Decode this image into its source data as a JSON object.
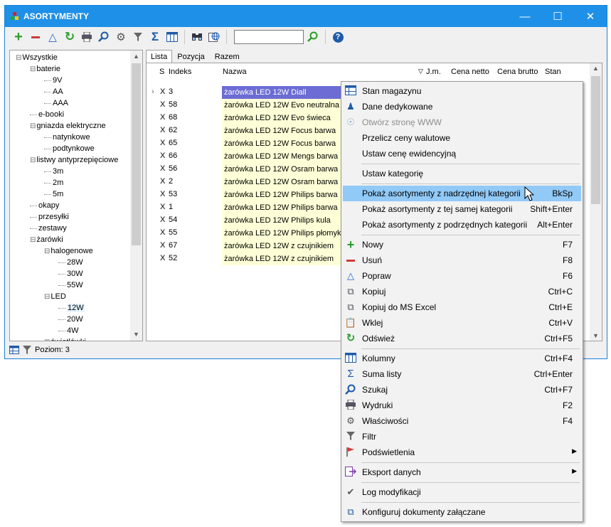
{
  "window": {
    "title": "ASORTYMENTY",
    "minimize": "—",
    "maximize": "☐",
    "close": "✕"
  },
  "toolbar": {
    "search_value": ""
  },
  "tree": {
    "items": [
      {
        "label": "Wszystkie",
        "level": 0,
        "expander": "⊟"
      },
      {
        "label": "baterie",
        "level": 1,
        "expander": "⊟"
      },
      {
        "label": "9V",
        "level": 2
      },
      {
        "label": "AA",
        "level": 2
      },
      {
        "label": "AAA",
        "level": 2
      },
      {
        "label": "e-booki",
        "level": 1
      },
      {
        "label": "gniazda elektryczne",
        "level": 1,
        "expander": "⊟"
      },
      {
        "label": "natynkowe",
        "level": 2
      },
      {
        "label": "podtynkowe",
        "level": 2
      },
      {
        "label": "listwy antyprzepięciowe",
        "level": 1,
        "expander": "⊟"
      },
      {
        "label": "3m",
        "level": 2
      },
      {
        "label": "2m",
        "level": 2
      },
      {
        "label": "5m",
        "level": 2
      },
      {
        "label": "okapy",
        "level": 1
      },
      {
        "label": "przesyłki",
        "level": 1
      },
      {
        "label": "zestawy",
        "level": 1
      },
      {
        "label": "żarówki",
        "level": 1,
        "expander": "⊟"
      },
      {
        "label": "halogenowe",
        "level": 2,
        "expander": "⊟"
      },
      {
        "label": "28W",
        "level": 3
      },
      {
        "label": "30W",
        "level": 3
      },
      {
        "label": "55W",
        "level": 3
      },
      {
        "label": "LED",
        "level": 2,
        "expander": "⊟"
      },
      {
        "label": "12W",
        "level": 3,
        "selected": true
      },
      {
        "label": "20W",
        "level": 3
      },
      {
        "label": "4W",
        "level": 3
      },
      {
        "label": "świetlówki",
        "level": 2,
        "expander": "⊞"
      }
    ]
  },
  "tabs": [
    "Lista",
    "Pozycja",
    "Razem"
  ],
  "grid": {
    "columns": {
      "s": "S",
      "indeks": "Indeks",
      "nazwa": "Nazwa",
      "jm": "J.m.",
      "cena_netto": "Cena netto",
      "cena_brutto": "Cena brutto",
      "stan": "Stan"
    },
    "rows": [
      {
        "s": "X",
        "indeks": "3",
        "nazwa": "żarówka LED 12W Diall",
        "selected": true
      },
      {
        "s": "X",
        "indeks": "58",
        "nazwa": "żarówka LED 12W Evo neutralna"
      },
      {
        "s": "X",
        "indeks": "68",
        "nazwa": "żarówka LED 12W Evo świeca"
      },
      {
        "s": "X",
        "indeks": "62",
        "nazwa": "żarówka LED 12W Focus barwa ciepła"
      },
      {
        "s": "X",
        "indeks": "65",
        "nazwa": "żarówka LED 12W Focus barwa zimna"
      },
      {
        "s": "X",
        "indeks": "66",
        "nazwa": "żarówka LED 12W Mengs barwa zimna"
      },
      {
        "s": "X",
        "indeks": "56",
        "nazwa": "żarówka LED 12W Osram barwa biała"
      },
      {
        "s": "X",
        "indeks": "2",
        "nazwa": "żarówka LED 12W Osram barwa zimna"
      },
      {
        "s": "X",
        "indeks": "53",
        "nazwa": "żarówka LED 12W Philips barwa ciepła"
      },
      {
        "s": "X",
        "indeks": "1",
        "nazwa": "żarówka LED 12W Philips barwa zimna"
      },
      {
        "s": "X",
        "indeks": "54",
        "nazwa": "żarówka LED 12W Philips kula"
      },
      {
        "s": "X",
        "indeks": "55",
        "nazwa": "żarówka LED 12W Philips płomyk"
      },
      {
        "s": "X",
        "indeks": "67",
        "nazwa": "żarówka LED 12W z czujnikiem ruchu"
      },
      {
        "s": "X",
        "indeks": "52",
        "nazwa": "żarówka LED 12W z czujnikiem ruchu"
      }
    ]
  },
  "status": {
    "text": "Poziom: 3"
  },
  "context_menu": {
    "items": [
      {
        "label": "Stan magazynu",
        "icon": "table-icon",
        "shortcut": ""
      },
      {
        "label": "Dane dedykowane",
        "icon": "users-icon",
        "shortcut": ""
      },
      {
        "label": "Otwórz stronę WWW",
        "icon": "globe-icon",
        "shortcut": "",
        "disabled": true
      },
      {
        "label": "Przelicz ceny walutowe",
        "icon": "",
        "shortcut": ""
      },
      {
        "label": "Ustaw cenę ewidencyjną",
        "icon": "",
        "shortcut": ""
      },
      {
        "sep": true
      },
      {
        "label": "Ustaw kategorię",
        "icon": "",
        "shortcut": ""
      },
      {
        "sep": true
      },
      {
        "label": "Pokaż asortymenty z nadrzędnej kategorii",
        "icon": "",
        "shortcut": "BkSp",
        "highlight": true
      },
      {
        "label": "Pokaż asortymenty z tej samej kategorii",
        "icon": "",
        "shortcut": "Shift+Enter"
      },
      {
        "label": "Pokaż asortymenty z podrzędnych kategorii",
        "icon": "",
        "shortcut": "Alt+Enter"
      },
      {
        "sep": true
      },
      {
        "label": "Nowy",
        "icon": "plus-icon",
        "shortcut": "F7"
      },
      {
        "label": "Usuń",
        "icon": "minus-icon",
        "shortcut": "F8"
      },
      {
        "label": "Popraw",
        "icon": "edit-triangle-icon",
        "shortcut": "F6"
      },
      {
        "label": "Kopiuj",
        "icon": "copy-icon",
        "shortcut": "Ctrl+C"
      },
      {
        "label": "Kopiuj do MS Excel",
        "icon": "excel-copy-icon",
        "shortcut": "Ctrl+E"
      },
      {
        "label": "Wklej",
        "icon": "paste-icon",
        "shortcut": "Ctrl+V"
      },
      {
        "label": "Odśwież",
        "icon": "refresh-icon",
        "shortcut": "Ctrl+F5"
      },
      {
        "sep": true
      },
      {
        "label": "Kolumny",
        "icon": "columns-icon",
        "shortcut": "Ctrl+F4"
      },
      {
        "label": "Suma listy",
        "icon": "sigma-icon",
        "shortcut": "Ctrl+Enter"
      },
      {
        "label": "Szukaj",
        "icon": "search-icon",
        "shortcut": "Ctrl+F7"
      },
      {
        "label": "Wydruki",
        "icon": "printer-icon",
        "shortcut": "F2"
      },
      {
        "label": "Właściwości",
        "icon": "gear-icon",
        "shortcut": "F4"
      },
      {
        "label": "Filtr",
        "icon": "filter-icon",
        "shortcut": ""
      },
      {
        "label": "Podświetlenia",
        "icon": "flag-icon",
        "shortcut": "",
        "submenu": true
      },
      {
        "sep": true
      },
      {
        "label": "Eksport danych",
        "icon": "export-icon",
        "shortcut": "",
        "submenu": true
      },
      {
        "sep": true
      },
      {
        "label": "Log modyfikacji",
        "icon": "log-icon",
        "shortcut": ""
      },
      {
        "sep": true
      },
      {
        "label": "Konfiguruj dokumenty załączane",
        "icon": "attachments-icon",
        "shortcut": ""
      }
    ]
  }
}
